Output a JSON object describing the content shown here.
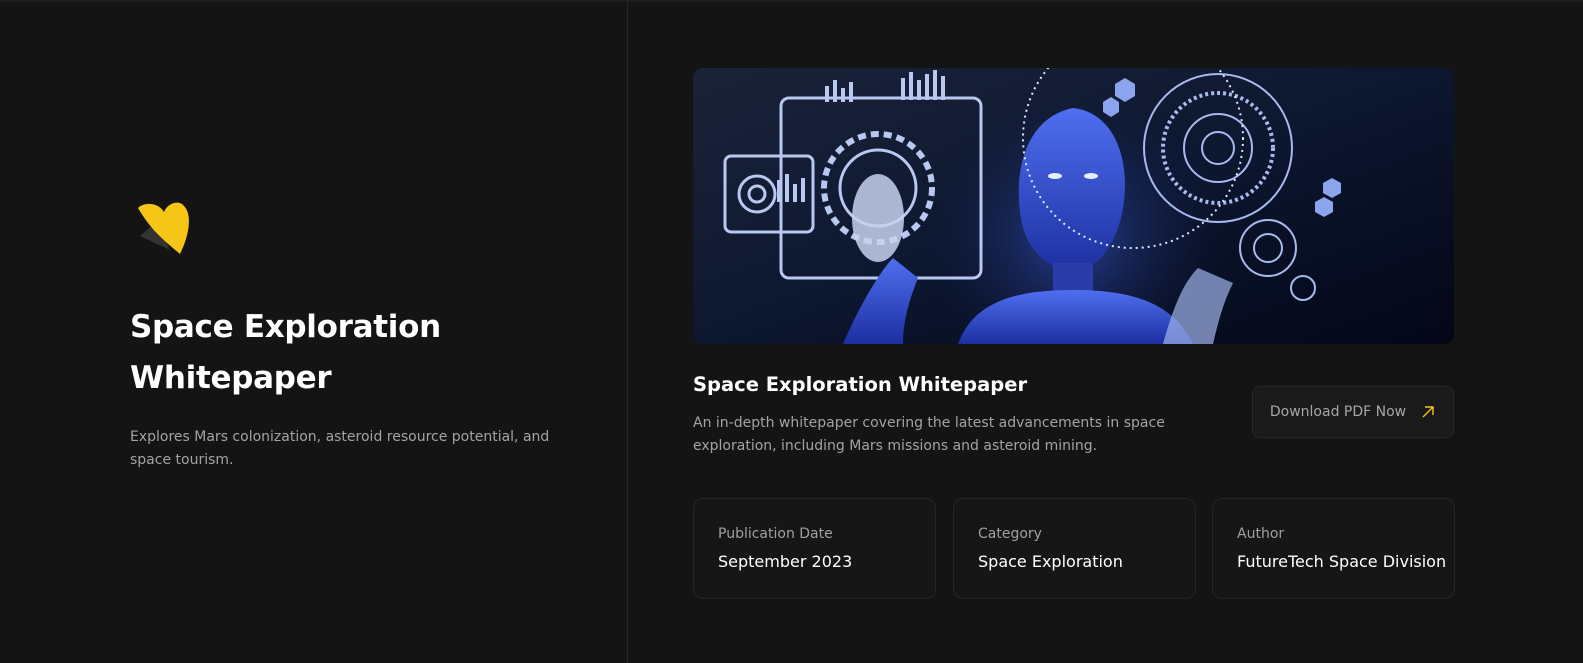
{
  "left": {
    "logo_icon": "abstract-yellow-bird-logo",
    "title": "Space Exploration Whitepaper",
    "description": "Explores Mars colonization, asteroid resource potential, and space tourism."
  },
  "right": {
    "hero_image": "blue-robot-holographic-interface",
    "title": "Space Exploration Whitepaper",
    "description": "An in-depth whitepaper covering the latest advancements in space exploration, including Mars missions and asteroid mining.",
    "download": {
      "label": "Download PDF Now",
      "icon": "arrow-up-right-icon"
    },
    "cards": [
      {
        "label": "Publication Date",
        "value": "September 2023"
      },
      {
        "label": "Category",
        "value": "Space Exploration"
      },
      {
        "label": "Author",
        "value": "FutureTech Space Division"
      }
    ]
  },
  "colors": {
    "background": "#141414",
    "accent": "#f5c518",
    "text_primary": "#ffffff",
    "text_secondary": "#a3a3a3",
    "card_border": "#262626"
  }
}
